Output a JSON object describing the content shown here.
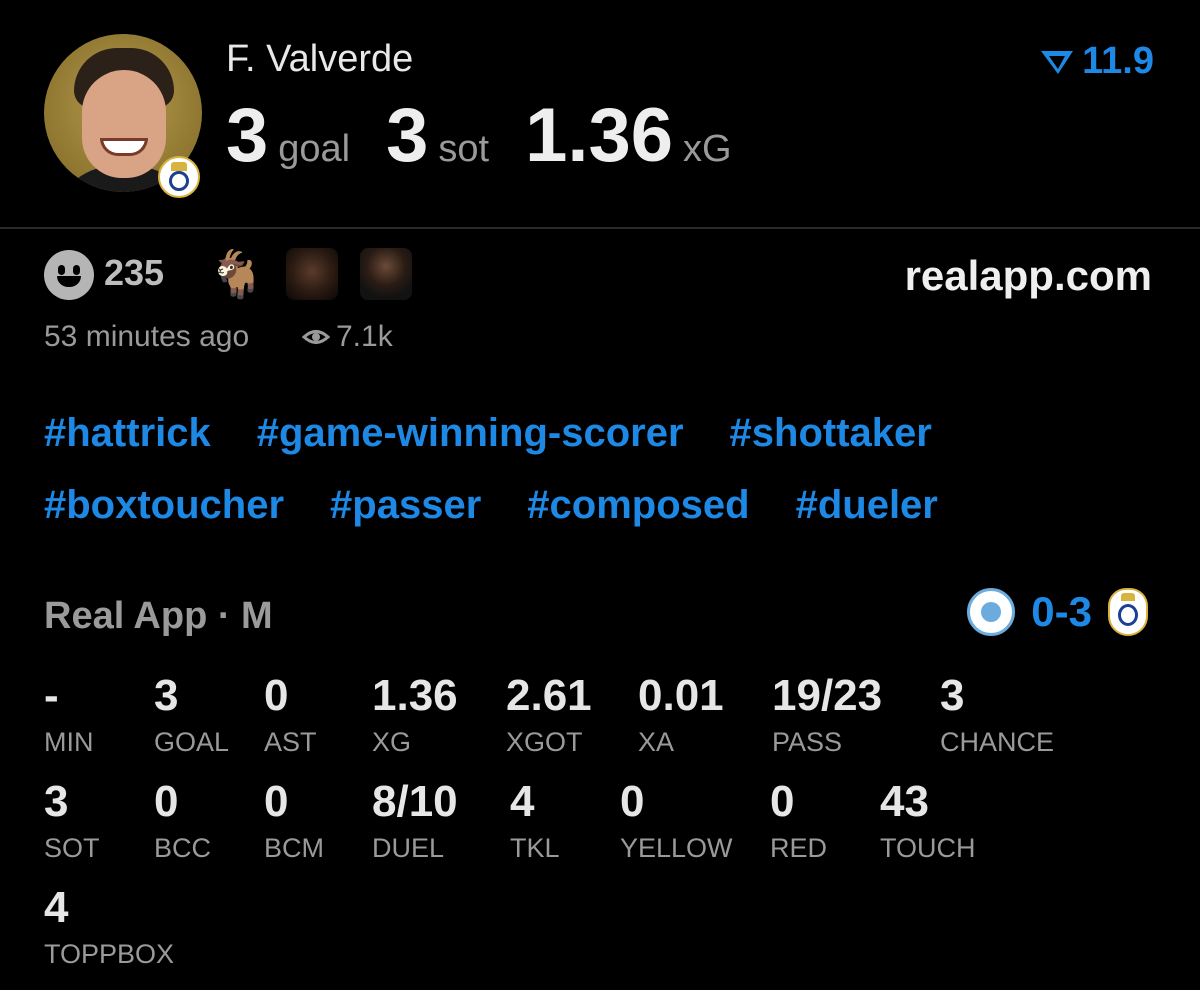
{
  "player": {
    "name": "F. Valverde",
    "goals": "3",
    "goals_unit": "goal",
    "sot": "3",
    "sot_unit": "sot",
    "xg": "1.36",
    "xg_unit": "xG",
    "rating": "11.9"
  },
  "engagement": {
    "reaction_count": "235",
    "site": "realapp.com",
    "time": "53 minutes ago",
    "views": "7.1k"
  },
  "tags": [
    [
      "#hattrick",
      "#game-winning-scorer",
      "#shottaker"
    ],
    [
      "#boxtoucher",
      "#passer",
      "#composed",
      "#dueler"
    ]
  ],
  "match": {
    "label": "Real App · M",
    "score": "0-3"
  },
  "stats": [
    {
      "value": "-",
      "label": "MIN"
    },
    {
      "value": "3",
      "label": "GOAL"
    },
    {
      "value": "0",
      "label": "AST"
    },
    {
      "value": "1.36",
      "label": "XG"
    },
    {
      "value": "2.61",
      "label": "XGOT"
    },
    {
      "value": "0.01",
      "label": "XA"
    },
    {
      "value": "19/23",
      "label": "PASS"
    },
    {
      "value": "3",
      "label": "CHANCE"
    },
    {
      "value": "3",
      "label": "SOT"
    },
    {
      "value": "0",
      "label": "BCC"
    },
    {
      "value": "0",
      "label": "BCM"
    },
    {
      "value": "8/10",
      "label": "DUEL"
    },
    {
      "value": "4",
      "label": "TKL"
    },
    {
      "value": "0",
      "label": "YELLOW"
    },
    {
      "value": "0",
      "label": "RED"
    },
    {
      "value": "43",
      "label": "TOUCH"
    },
    {
      "value": "4",
      "label": "TOPPBOX"
    }
  ],
  "colors": {
    "background": "#000000",
    "accent": "#1e88e5",
    "muted": "#9a9a9a"
  }
}
